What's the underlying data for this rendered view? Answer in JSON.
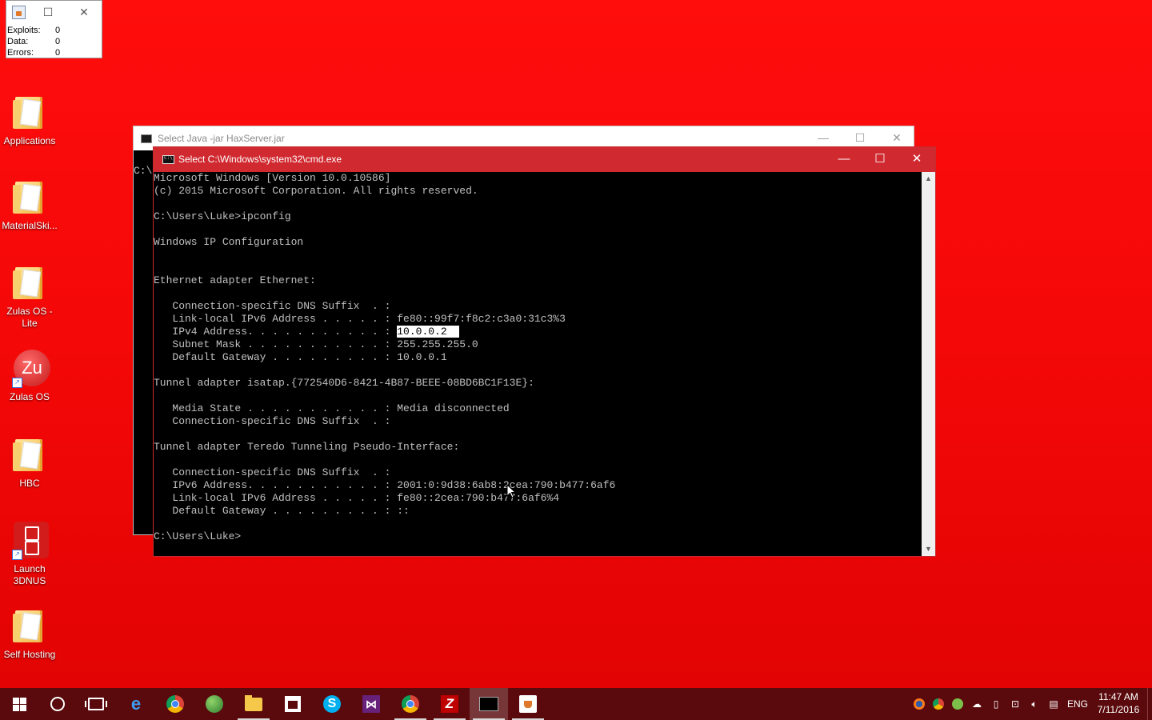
{
  "mini_widget": {
    "stats": [
      {
        "label": "Exploits:",
        "value": "0"
      },
      {
        "label": "Data:",
        "value": "0"
      },
      {
        "label": "Errors:",
        "value": "0"
      }
    ]
  },
  "desktop_icons": [
    {
      "name": "Applications",
      "label": "Applications"
    },
    {
      "name": "MaterialSkin",
      "label": "MaterialSki..."
    },
    {
      "name": "Zulas OS - Lite",
      "label": "Zulas OS -\nLite"
    },
    {
      "name": "Zulas OS",
      "label": "Zulas OS",
      "logo_text": "Zu"
    },
    {
      "name": "HBC",
      "label": "HBC"
    },
    {
      "name": "Launch 3DNUS",
      "label": "Launch\n3DNUS"
    },
    {
      "name": "Self Hosting",
      "label": "Self Hosting"
    }
  ],
  "java_window": {
    "title": "Select Java -jar HaxServer.jar",
    "prompt": "C:\\"
  },
  "cmd_window": {
    "title": "Select C:\\Windows\\system32\\cmd.exe",
    "buttons": {
      "minimize": "—",
      "maximize": "☐",
      "close": "✕"
    },
    "lines": [
      "Microsoft Windows [Version 10.0.10586]",
      "(c) 2015 Microsoft Corporation. All rights reserved.",
      "",
      "C:\\Users\\Luke>ipconfig",
      "",
      "Windows IP Configuration",
      "",
      "",
      "Ethernet adapter Ethernet:",
      "",
      "   Connection-specific DNS Suffix  . :",
      "   Link-local IPv6 Address . . . . . : fe80::99f7:f8c2:c3a0:31c3%3",
      "   IPv4 Address. . . . . . . . . . . : ",
      "   Subnet Mask . . . . . . . . . . . : 255.255.255.0",
      "   Default Gateway . . . . . . . . . : 10.0.0.1",
      "",
      "Tunnel adapter isatap.{772540D6-8421-4B87-BEEE-08BD6BC1F13E}:",
      "",
      "   Media State . . . . . . . . . . . : Media disconnected",
      "   Connection-specific DNS Suffix  . :",
      "",
      "Tunnel adapter Teredo Tunneling Pseudo-Interface:",
      "",
      "   Connection-specific DNS Suffix  . :",
      "   IPv6 Address. . . . . . . . . . . : 2001:0:9d38:6ab8:2cea:790:b477:6af6",
      "   Link-local IPv6 Address . . . . . : fe80::2cea:790:b477:6af6%4",
      "   Default Gateway . . . . . . . . . : ::",
      "",
      "C:\\Users\\Luke>"
    ],
    "selected_text": "10.0.0.2  "
  },
  "taskbar": {
    "apps": [
      "start",
      "search",
      "task-view",
      "edge",
      "chrome",
      "globe-app",
      "file-explorer",
      "store",
      "skype",
      "visual-studio",
      "chrome-alt",
      "filezilla",
      "cmd",
      "java"
    ],
    "tray": {
      "language": "ENG",
      "time": "11:47 AM",
      "date": "7/11/2016"
    }
  }
}
